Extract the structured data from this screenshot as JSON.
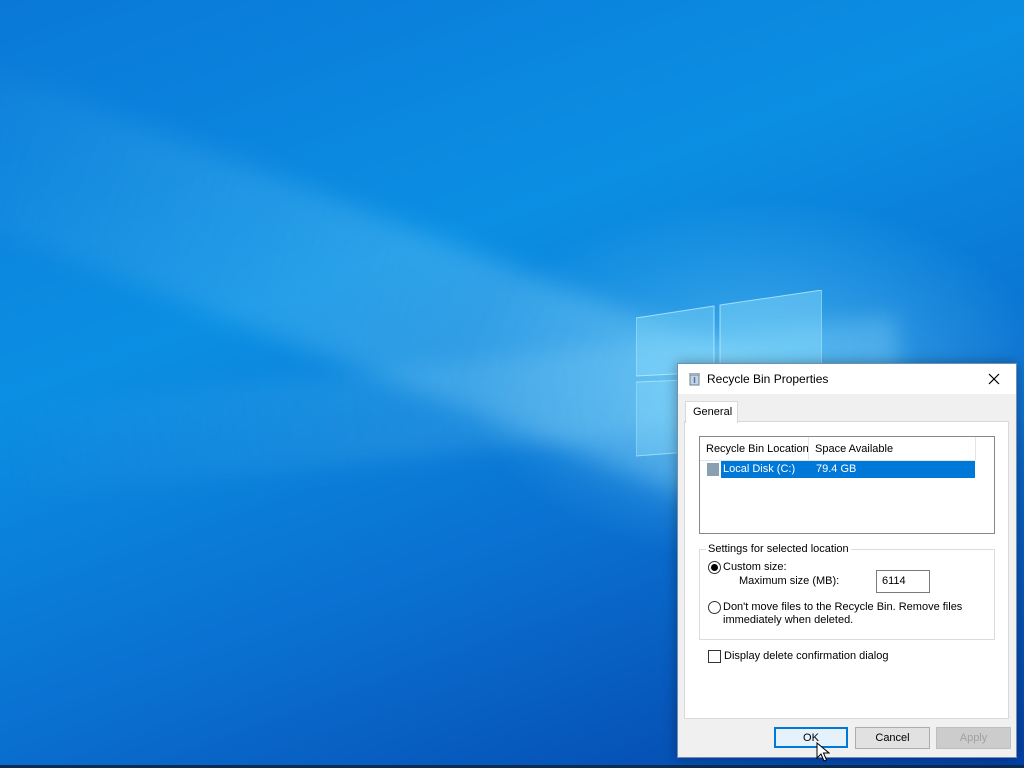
{
  "window": {
    "title": "Recycle Bin Properties",
    "tabs": [
      {
        "label": "General",
        "selected": true
      }
    ]
  },
  "listview": {
    "columns": [
      "Recycle Bin Location",
      "Space Available"
    ],
    "rows": [
      {
        "location": "Local Disk (C:)",
        "space": "79.4 GB",
        "selected": true
      }
    ]
  },
  "settings": {
    "group_label": "Settings for selected location",
    "custom_size_label": "Custom size:",
    "custom_size_selected": true,
    "max_size_label": "Maximum size (MB):",
    "max_size_value": "6114",
    "dont_move_label": "Don't move files to the Recycle Bin. Remove files immediately when deleted.",
    "dont_move_selected": false
  },
  "confirm_dialog": {
    "label": "Display delete confirmation dialog",
    "checked": false
  },
  "buttons": {
    "ok": "OK",
    "cancel": "Cancel",
    "apply": "Apply",
    "apply_enabled": false
  },
  "colors": {
    "desktop": "#0a78d7",
    "selection": "#0078d7",
    "focus_border": "#0078d7"
  }
}
